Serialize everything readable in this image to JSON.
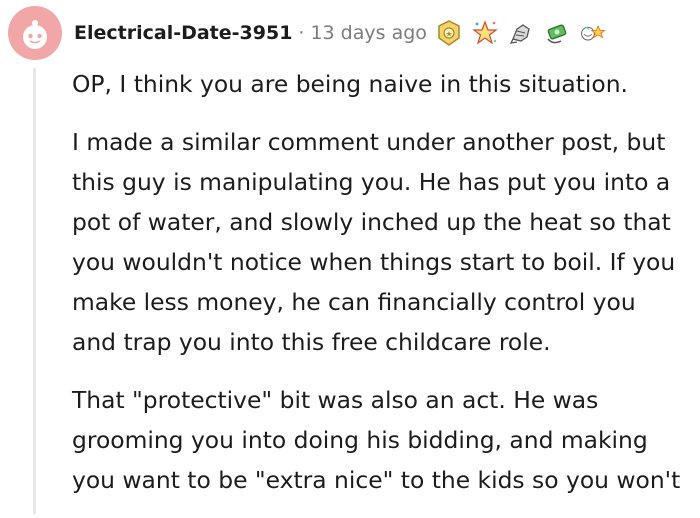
{
  "comment": {
    "username": "Electrical-Date-3951",
    "separator": "·",
    "timestamp": "13 days ago",
    "awards": [
      "helpful-award-icon",
      "wholesome-award-icon",
      "silver-hands-award-icon",
      "take-my-money-award-icon",
      "starstruck-award-icon"
    ],
    "paragraphs": [
      "OP, I think you are being naive in this situation.",
      "I made a similar comment under another post, but\nthis guy is manipulating you. He has put you into a\npot of water, and slowly inched up the heat so that\nyou wouldn't notice when things start to boil. If you\nmake less money, he can financially control you\nand trap you into this free childcare role.",
      "That \"protective\" bit was also an act. He was\ngrooming you into doing his bidding, and making\nyou want to be \"extra nice\" to the kids so you won't"
    ]
  },
  "colors": {
    "avatar_bg": "#f1a7a7",
    "meta_text": "#7c7c7c",
    "thread_line": "#e6e6e6"
  }
}
